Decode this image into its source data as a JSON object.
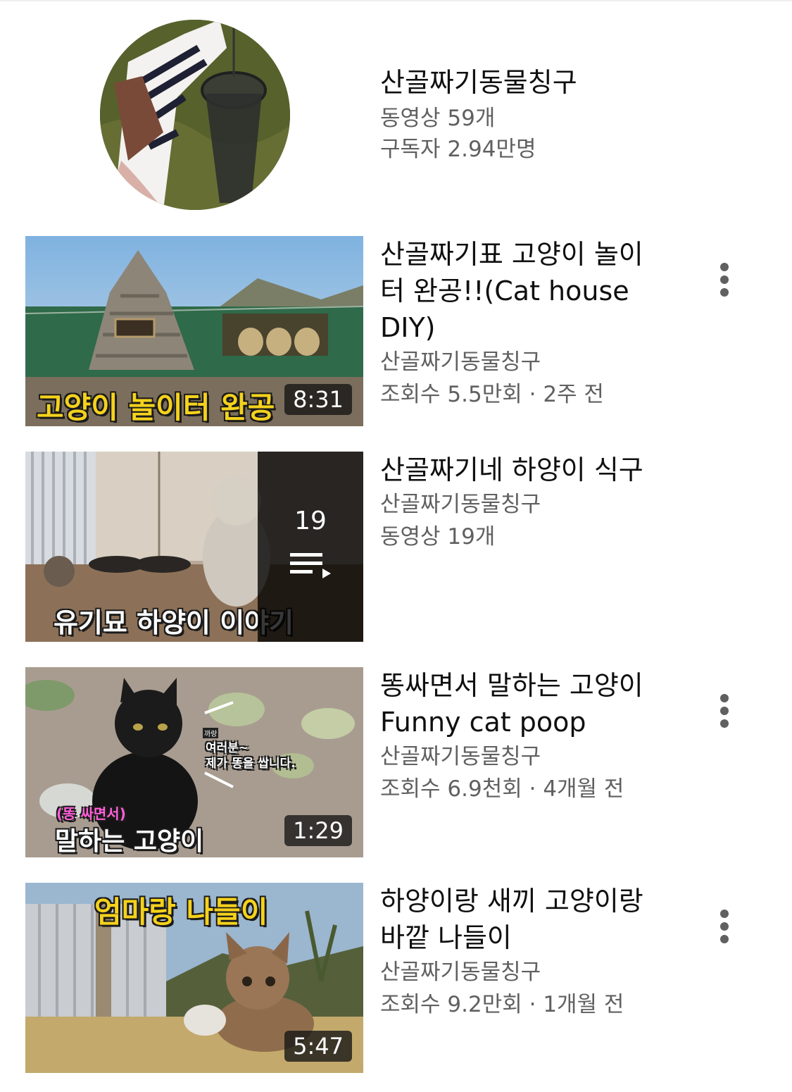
{
  "channel": {
    "name": "산골짜기동물칭구",
    "videos": "동영상 59개",
    "subscribers": "구독자 2.94만명"
  },
  "items": [
    {
      "type": "video",
      "title": "산골짜기표 고양이 놀이터 완공!!(Cat house DIY)",
      "channel": "산골짜기동물칭구",
      "stats": "조회수 5.5만회 · 2주 전",
      "duration": "8:31",
      "overlay_text": "고양이 놀이터 완공",
      "overlay_color": "#f5d21c",
      "menu_icon": "more-vert-icon"
    },
    {
      "type": "playlist",
      "title": "산골짜기네 하양이 식구",
      "channel": "산골짜기동물칭구",
      "stats": "동영상 19개",
      "count": "19",
      "overlay_text": "유기묘 하양이 이야기",
      "overlay_color": "#ffffff",
      "menu_icon": "playlist-icon"
    },
    {
      "type": "video",
      "title": "똥싸면서 말하는 고양이 Funny cat poop",
      "channel": "산골짜기동물칭구",
      "stats": "조회수 6.9천회 · 4개월 전",
      "duration": "1:29",
      "overlay_top": "(똥 싸면서)",
      "overlay_text": "말하는 고양이",
      "bubble_small": "까랑",
      "bubble_text_1": "여러분~",
      "bubble_text_2": "제가 똥을 쌉니다.",
      "overlay_color": "#ffffff",
      "accent_color": "#ff5fd8",
      "menu_icon": "more-vert-icon"
    },
    {
      "type": "video",
      "title": "하양이랑 새끼 고양이랑 바깥 나들이",
      "channel": "산골짜기동물칭구",
      "stats": "조회수 9.2만회 · 1개월 전",
      "duration": "5:47",
      "overlay_text": "엄마랑 나들이",
      "overlay_color": "#f5d21c",
      "menu_icon": "more-vert-icon"
    }
  ]
}
